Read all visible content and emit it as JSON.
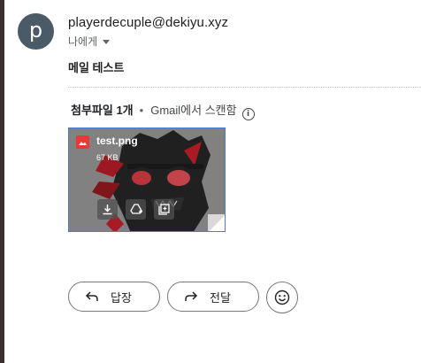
{
  "sender": {
    "avatar_letter": "p",
    "email": "playerdecuple@dekiyu.xyz",
    "recipient_label": "나에게"
  },
  "message": {
    "body": "메일 테스트"
  },
  "attachments": {
    "header_count": "첨부파일 1개",
    "separator": "•",
    "scan_label": "Gmail에서 스캔함",
    "items": [
      {
        "file_name": "test.png",
        "file_size": "67 KB",
        "type_icon": "image-file-icon"
      }
    ]
  },
  "actions": {
    "reply_label": "답장",
    "forward_label": "전달"
  },
  "colors": {
    "avatar_bg": "#4a5a66",
    "attachment_border": "#4a7cd6",
    "image_icon": "#e53935"
  }
}
